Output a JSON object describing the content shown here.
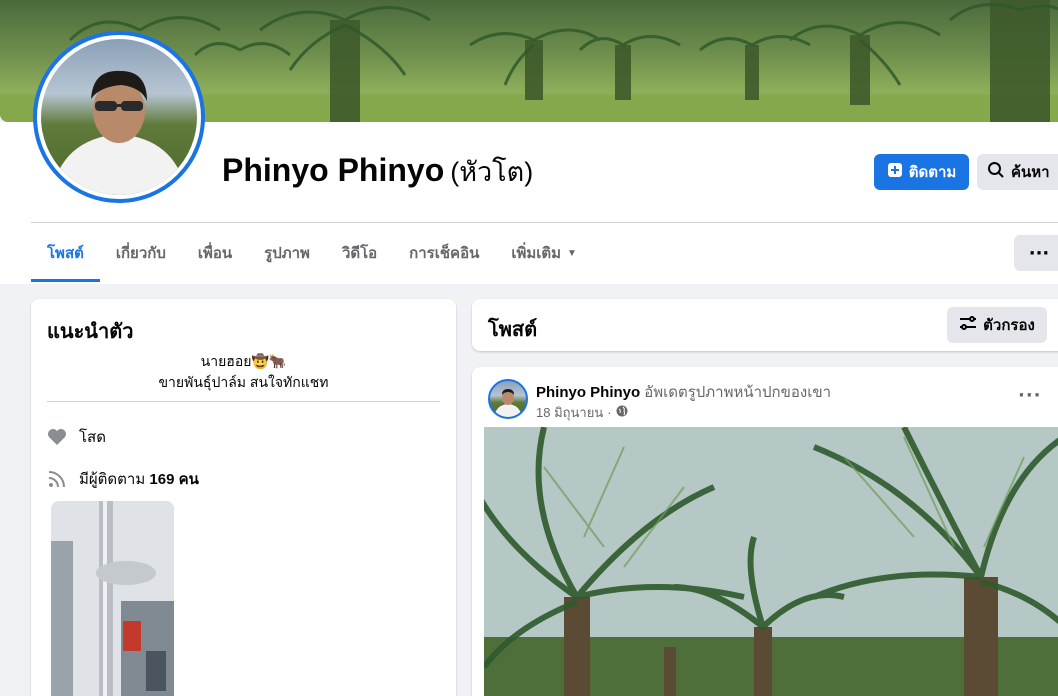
{
  "profile": {
    "name": "Phinyo Phinyo",
    "alternate_name": "(หัวโต)"
  },
  "actions": {
    "follow_label": "ติดตาม",
    "search_label": "ค้นหา",
    "more_label": "···"
  },
  "tabs": [
    {
      "label": "โพสต์",
      "active": true
    },
    {
      "label": "เกี่ยวกับ",
      "active": false
    },
    {
      "label": "เพื่อน",
      "active": false
    },
    {
      "label": "รูปภาพ",
      "active": false
    },
    {
      "label": "วิดีโอ",
      "active": false
    },
    {
      "label": "การเช็คอิน",
      "active": false
    },
    {
      "label": "เพิ่มเติม",
      "active": false
    }
  ],
  "intro": {
    "title": "แนะนำตัว",
    "bio_line1": "นายฮอย🤠🐂",
    "bio_line2": "ขายพันธุ์ปาล์ม สนใจทักแชท",
    "relationship": "โสด",
    "followers_prefix": "มีผู้ติดตาม",
    "followers_count": "169",
    "followers_suffix": "คน"
  },
  "posts_section": {
    "title": "โพสต์",
    "filter_label": "ตัวกรอง"
  },
  "post": {
    "author": "Phinyo Phinyo",
    "action": "อัพเดตรูปภาพหน้าปกของเขา",
    "date": "18 มิถุนายน",
    "separator": "·",
    "more_label": "···"
  },
  "colors": {
    "accent": "#1b74e4",
    "background": "#f0f2f5",
    "button_gray": "#e4e6eb",
    "secondary_text": "#65676b"
  },
  "icons": {
    "follow": "plus-square-icon",
    "search": "search-icon",
    "relationship": "heart-icon",
    "followers": "rss-icon",
    "filter": "sliders-icon",
    "privacy": "globe-icon"
  }
}
